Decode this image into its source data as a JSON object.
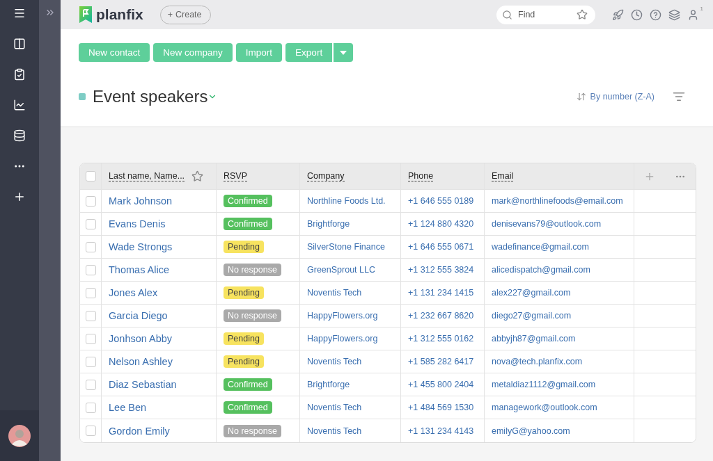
{
  "logo": {
    "text": "planfix"
  },
  "create_button": {
    "label": "Create",
    "icon": "+"
  },
  "search": {
    "placeholder": "Find"
  },
  "notifications": {
    "count": "1"
  },
  "actions": [
    "New contact",
    "New company",
    "Import",
    "Export"
  ],
  "list": {
    "title": "Event speakers",
    "sort": "By number (Z-A)"
  },
  "table": {
    "select_all": {
      "checked": false
    },
    "columns": [
      "Last name, Name...",
      "RSVP",
      "Company",
      "Phone",
      "Email"
    ],
    "rows": [
      {
        "checked": false,
        "name": "Mark Johnson",
        "rsvp": {
          "text": "Confirmed",
          "kind": "confirmed"
        },
        "company": "Northline Foods Ltd.",
        "phone": "+1 646 555 0189",
        "email": "mark@northlinefoods@email.com"
      },
      {
        "checked": false,
        "name": "Evans Denis",
        "rsvp": {
          "text": "Confirmed",
          "kind": "confirmed"
        },
        "company": "Brightforge",
        "phone": "+1 124 880 4320",
        "email": "denisevans79@outlook.com"
      },
      {
        "checked": false,
        "name": "Wade Strongs",
        "rsvp": {
          "text": "Pending",
          "kind": "pending"
        },
        "company": "SilverStone Finance",
        "phone": "+1 646 555 0671",
        "email": "wadefinance@gmail.com"
      },
      {
        "checked": false,
        "name": "Thomas Alice",
        "rsvp": {
          "text": "No response",
          "kind": "none"
        },
        "company": "GreenSprout LLC",
        "phone": "+1 312 555 3824",
        "email": "alicedispatch@gmail.com"
      },
      {
        "checked": false,
        "name": "Jones Alex",
        "rsvp": {
          "text": "Pending",
          "kind": "pending"
        },
        "company": "Noventis Tech",
        "phone": "+1 131 234 1415",
        "email": "alex227@gmail.com"
      },
      {
        "checked": false,
        "name": "Garcia Diego",
        "rsvp": {
          "text": "No response",
          "kind": "none"
        },
        "company": "HappyFlowers.org",
        "phone": "+1 232 667 8620",
        "email": "diego27@gmail.com"
      },
      {
        "checked": false,
        "name": "Jonhson Abby",
        "rsvp": {
          "text": "Pending",
          "kind": "pending"
        },
        "company": "HappyFlowers.org",
        "phone": "+1 312 555 0162",
        "email": "abbyjh87@gmail.com"
      },
      {
        "checked": false,
        "name": "Nelson Ashley",
        "rsvp": {
          "text": "Pending",
          "kind": "pending"
        },
        "company": "Noventis Tech",
        "phone": "+1 585 282 6417",
        "email": "nova@tech.planfix.com"
      },
      {
        "checked": false,
        "name": "Diaz Sebastian",
        "rsvp": {
          "text": "Confirmed",
          "kind": "confirmed"
        },
        "company": "Brightforge",
        "phone": "+1 455 800 2404",
        "email": "metaldiaz1112@gmail.com"
      },
      {
        "checked": false,
        "name": "Lee Ben",
        "rsvp": {
          "text": "Confirmed",
          "kind": "confirmed"
        },
        "company": "Noventis Tech",
        "phone": "+1 484 569 1530",
        "email": "managework@outlook.com"
      },
      {
        "checked": false,
        "name": "Gordon Emily",
        "rsvp": {
          "text": "No response",
          "kind": "none"
        },
        "company": "Noventis Tech",
        "phone": "+1 131 234 4143",
        "email": "emilyG@yahoo.com"
      }
    ]
  }
}
